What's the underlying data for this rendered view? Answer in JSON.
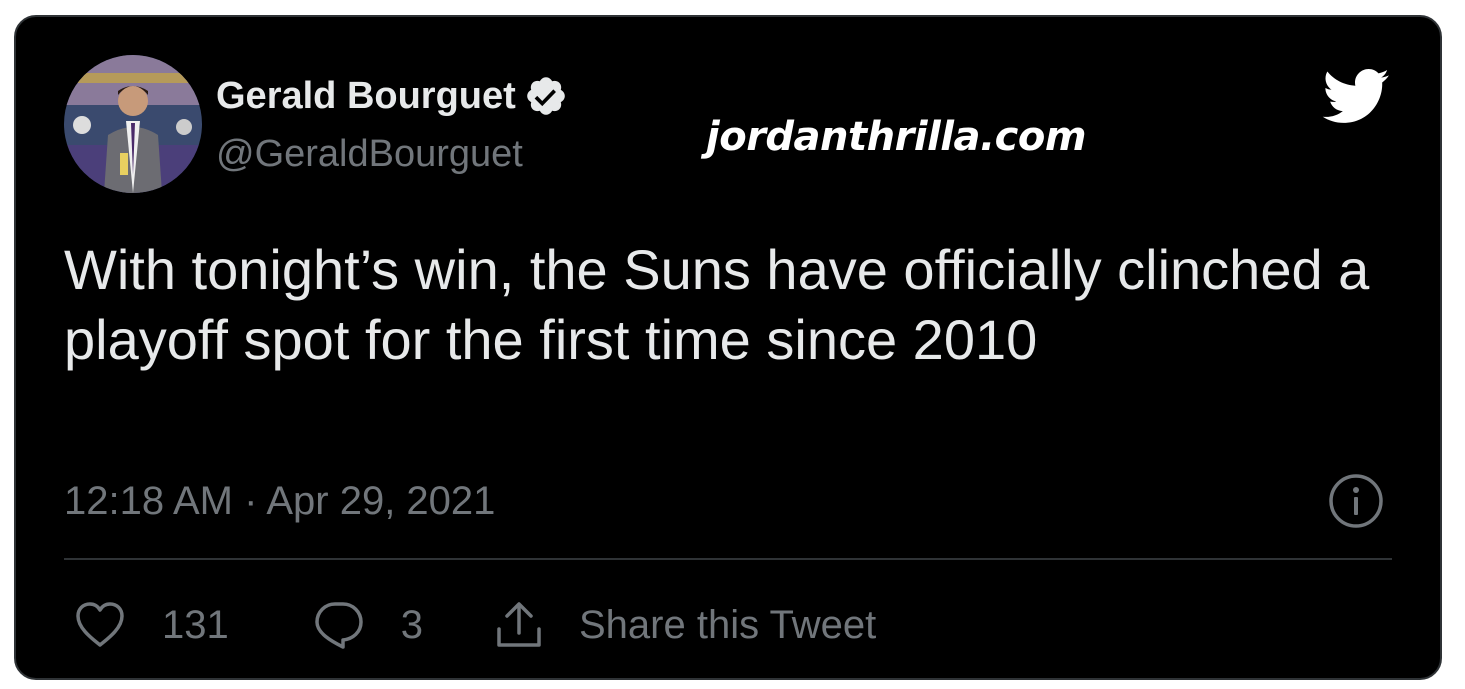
{
  "author": {
    "display_name": "Gerald Bourguet",
    "handle": "@GeraldBourguet",
    "verified_icon": "verified-badge-icon",
    "avatar": "avatar-photo"
  },
  "watermark": "jordanthrilla.com",
  "tweet": {
    "text": "With tonight’s win, the Suns have officially clinched a playoff spot for the first time since 2010",
    "timestamp": "12:18 AM · Apr 29, 2021"
  },
  "actions": {
    "likes": "131",
    "replies": "3",
    "share_label": "Share this Tweet"
  },
  "icons": {
    "brand": "twitter-bird-icon",
    "info": "info-icon",
    "like": "heart-icon",
    "reply": "reply-bubble-icon",
    "share": "share-upload-icon"
  },
  "colors": {
    "background": "#000000",
    "primary_text": "#e7e9ea",
    "secondary_text": "#71767b",
    "divider": "#2f3336",
    "bird": "#ffffff"
  }
}
